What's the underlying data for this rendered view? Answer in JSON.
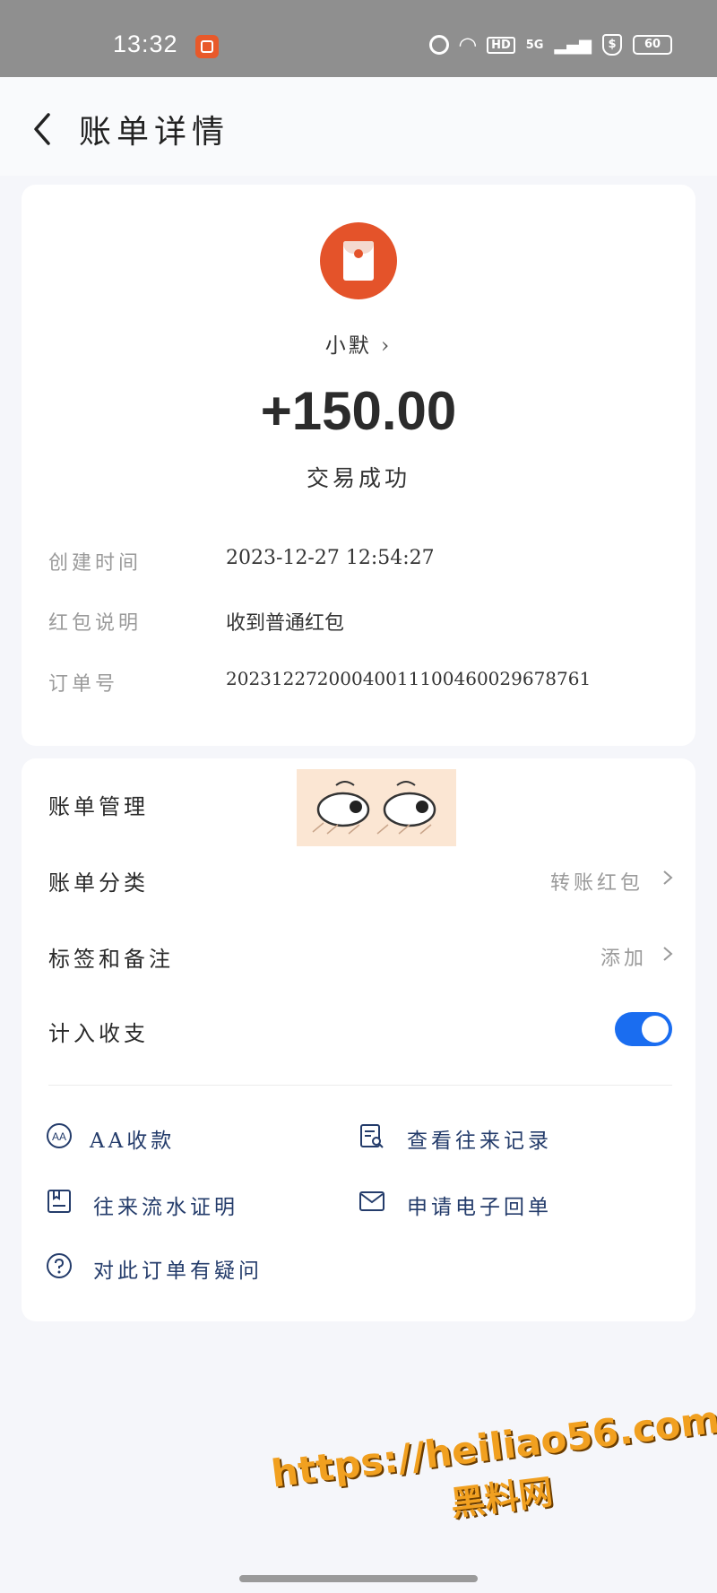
{
  "status_bar": {
    "time": "13:32",
    "network_hd": "HD",
    "network_5g": "5G",
    "battery": "60"
  },
  "header": {
    "title": "账单详情"
  },
  "summary": {
    "payer": "小默",
    "amount": "+150.00",
    "status": "交易成功"
  },
  "details": [
    {
      "label": "创建时间",
      "value": "2023-12-27 12:54:27"
    },
    {
      "label": "红包说明",
      "value": "收到普通红包"
    },
    {
      "label": "订单号",
      "value": "20231227200040011100460029678761"
    }
  ],
  "management": {
    "title": "账单管理",
    "category_label": "账单分类",
    "category_value": "转账红包",
    "tags_label": "标签和备注",
    "tags_value": "添加",
    "include_label": "计入收支"
  },
  "actions": [
    {
      "label": "AA收款"
    },
    {
      "label": "查看往来记录"
    },
    {
      "label": "往来流水证明"
    },
    {
      "label": "申请电子回单"
    },
    {
      "label": "对此订单有疑问"
    }
  ],
  "watermark": {
    "url": "https://heiliao56.com",
    "name": "黑料网"
  },
  "colors": {
    "accent_blue": "#1a6df0",
    "red_packet": "#e4532a",
    "action_text": "#243c6b"
  }
}
